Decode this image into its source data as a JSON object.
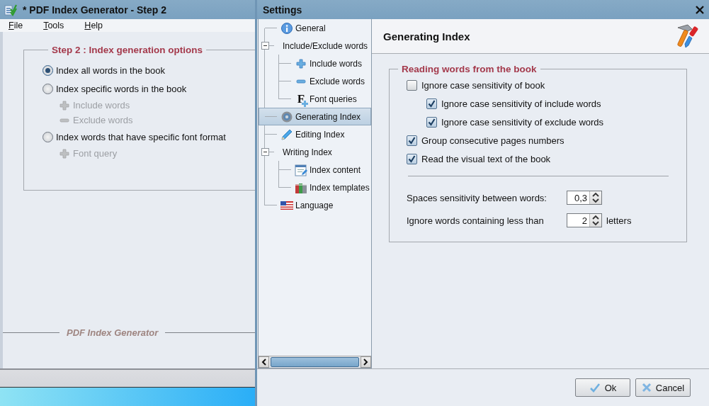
{
  "main_window": {
    "title": "* PDF Index Generator - Step 2",
    "menu": [
      {
        "label": "File"
      },
      {
        "label": "Tools"
      },
      {
        "label": "Help"
      }
    ],
    "group_title": "Step 2 : Index generation options",
    "options": [
      {
        "label": "Index all words in the book",
        "selected": true
      },
      {
        "label": "Index specific words in the book",
        "selected": false,
        "sub_options": [
          {
            "label": "Include words",
            "disabled": true
          },
          {
            "label": "Exclude words",
            "disabled": true
          }
        ]
      },
      {
        "label": "Index words that have specific font format",
        "selected": false,
        "sub_options": [
          {
            "label": "Font query",
            "disabled": true
          }
        ]
      }
    ],
    "footer": "PDF Index Generator"
  },
  "settings": {
    "title": "Settings",
    "tree": [
      {
        "label": "General",
        "selected": false
      },
      {
        "label": "Include/Exclude words",
        "selected": false,
        "expanded": true,
        "children": [
          {
            "label": "Include words",
            "selected": false
          },
          {
            "label": "Exclude words",
            "selected": false
          },
          {
            "label": "Font queries",
            "selected": false,
            "icon_text": "F"
          }
        ]
      },
      {
        "label": "Generating Index",
        "selected": true
      },
      {
        "label": "Editing Index",
        "selected": false
      },
      {
        "label": "Writing Index",
        "selected": false,
        "expanded": true,
        "children": [
          {
            "label": "Index content",
            "selected": false
          },
          {
            "label": "Index templates",
            "selected": false
          }
        ]
      },
      {
        "label": "Language",
        "selected": false
      }
    ],
    "page_title": "Generating Index",
    "group_title": "Reading words from the book",
    "checkboxes": [
      {
        "label": "Ignore case sensitivity of book",
        "checked": false,
        "children": [
          {
            "label": "Ignore case sensitivity of include words",
            "checked": true
          },
          {
            "label": "Ignore case sensitivity of exclude words",
            "checked": true
          }
        ]
      },
      {
        "label": "Group consecutive pages numbers",
        "checked": true
      },
      {
        "label": "Read the visual text of the book",
        "checked": true
      }
    ],
    "spinners": [
      {
        "label": "Spaces sensitivity between words:",
        "value": "0,3"
      },
      {
        "label": "Ignore words containing less than",
        "value": "2",
        "suffix": "letters"
      }
    ],
    "buttons": [
      {
        "label": "Ok"
      },
      {
        "label": "Cancel"
      }
    ]
  }
}
